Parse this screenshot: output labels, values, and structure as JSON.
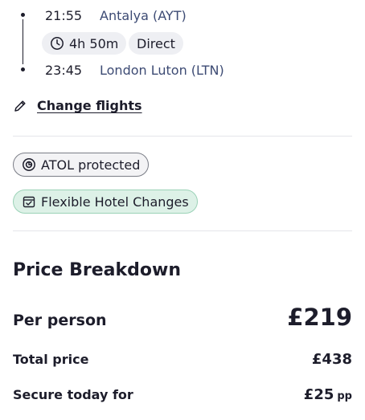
{
  "flight": {
    "departure": {
      "time": "21:55",
      "place": "Antalya (AYT)"
    },
    "duration": "4h 50m",
    "stops": "Direct",
    "arrival": {
      "time": "23:45",
      "place": "London Luton (LTN)"
    }
  },
  "change_flights_label": "Change flights",
  "badges": {
    "atol": "ATOL protected",
    "hotel": "Flexible Hotel Changes"
  },
  "price_breakdown": {
    "title": "Price Breakdown",
    "per_person_label": "Per person",
    "per_person_value": "£219",
    "total_label": "Total price",
    "total_value": "£438",
    "secure_label": "Secure today for",
    "secure_value": "£25",
    "secure_suffix": "pp"
  },
  "colors": {
    "text": "#1d1d2b",
    "place_text": "#3d4b74",
    "pill_bg": "#eeeff3",
    "hotel_badge_bg": "#ddf1e7",
    "hotel_badge_border": "#9bd2b7"
  },
  "icons": {
    "duration": "clock-icon",
    "change": "pencil-icon",
    "atol": "atol-shield-icon",
    "hotel": "calendar-check-icon"
  }
}
